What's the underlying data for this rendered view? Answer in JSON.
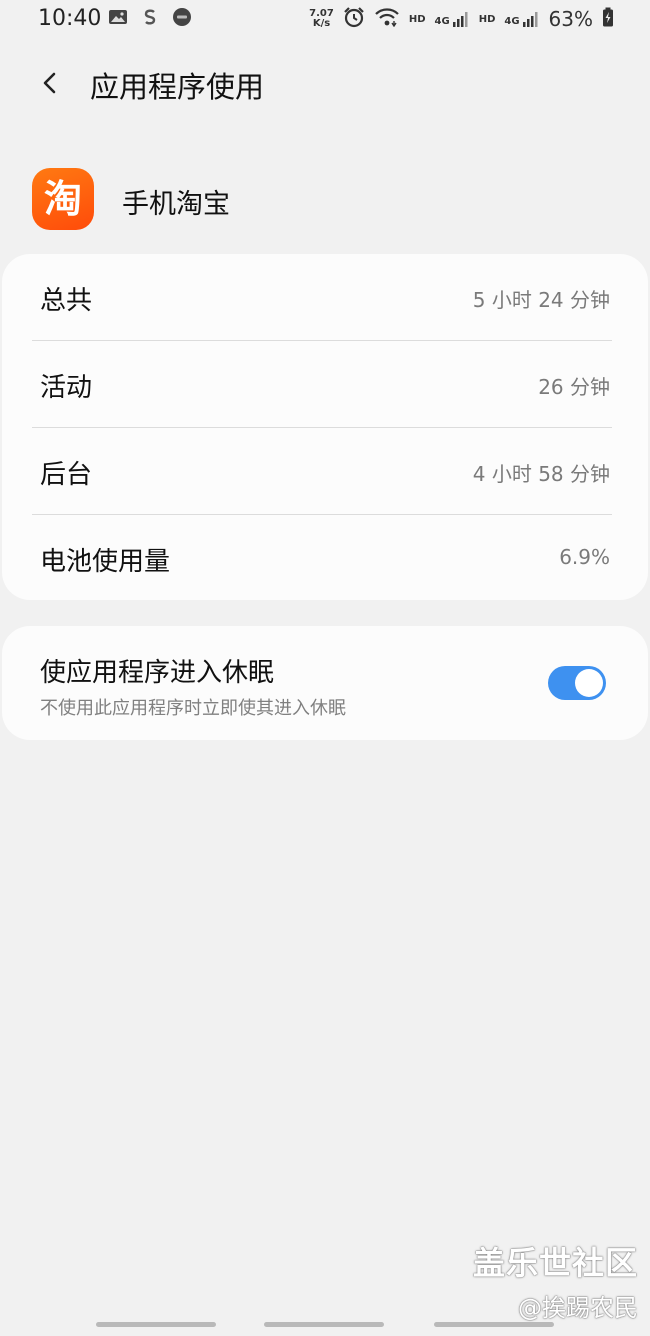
{
  "status_bar": {
    "time": "10:40",
    "net_speed_value": "7.07",
    "net_speed_unit": "K/s",
    "hd1": "HD",
    "net1": "4G",
    "hd2": "HD",
    "net2": "4G",
    "battery": "63%",
    "icons": [
      "image-icon",
      "s-app-icon",
      "dolby-icon",
      "alarm-icon",
      "wifi-icon",
      "signal-icon",
      "battery-icon"
    ]
  },
  "header": {
    "title": "应用程序使用"
  },
  "app": {
    "icon_char": "淘",
    "name": "手机淘宝"
  },
  "usage": {
    "total_label": "总共",
    "total_value": "5 小时 24 分钟",
    "active_label": "活动",
    "active_value": "26 分钟",
    "background_label": "后台",
    "background_value": "4 小时 58 分钟",
    "battery_label": "电池使用量",
    "battery_value": "6.9%"
  },
  "sleep": {
    "title": "使应用程序进入休眠",
    "subtitle": "不使用此应用程序时立即使其进入休眠",
    "enabled": true
  },
  "watermark": {
    "title": "盖乐世社区",
    "author": "@挨踢农民"
  },
  "colors": {
    "background": "#f1f1f1",
    "card": "#fcfcfc",
    "toggle_on": "#3e91f0",
    "app_icon": "#ff5a0e"
  }
}
